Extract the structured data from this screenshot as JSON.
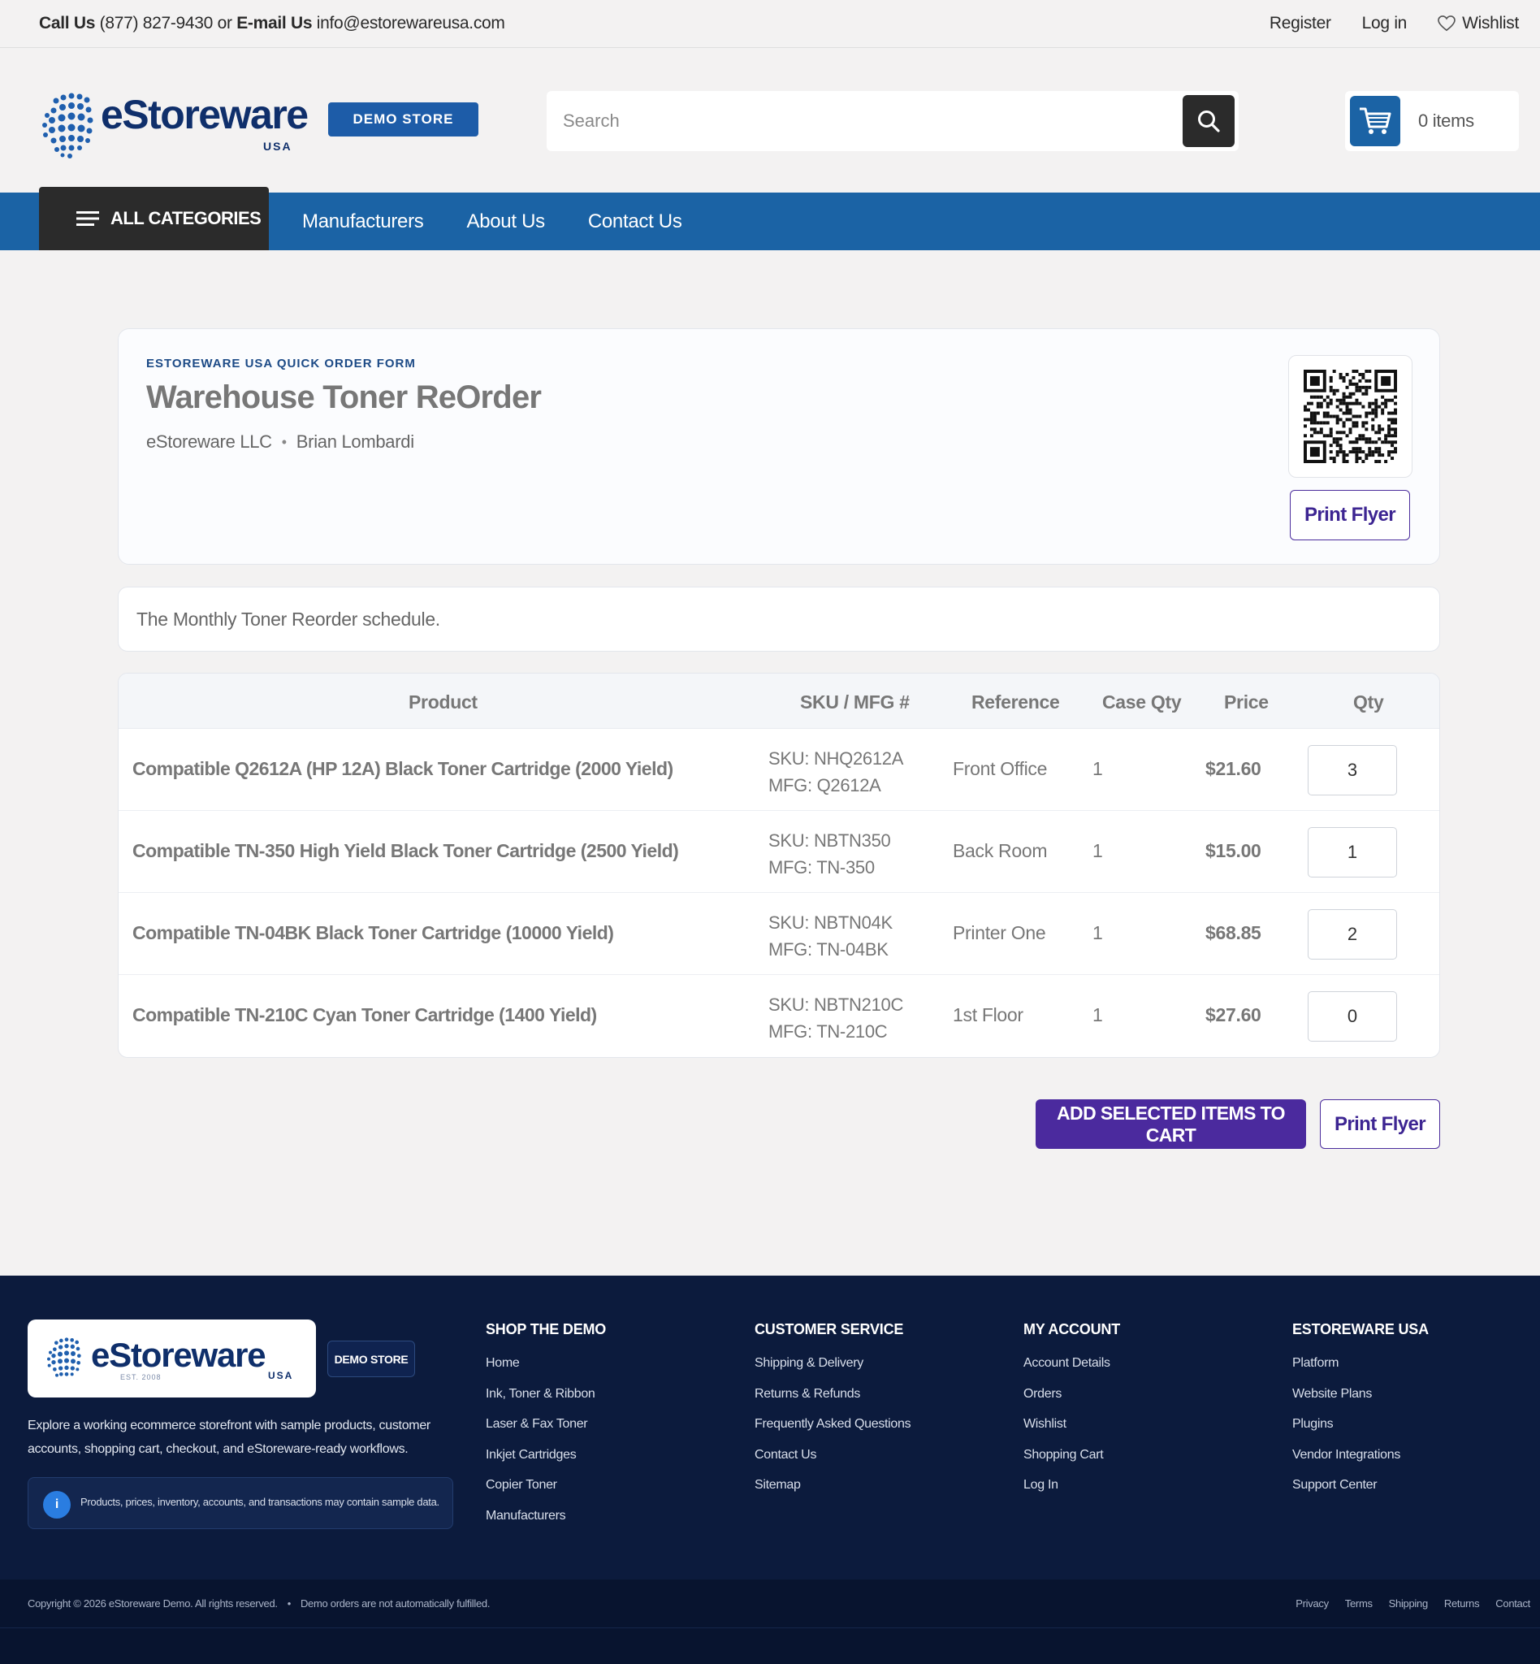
{
  "topbar": {
    "call_label": "Call Us",
    "phone": "(877) 827-9430",
    "or": "or",
    "email_label": "E-mail Us",
    "email": "info@estorewareusa.com",
    "register": "Register",
    "login": "Log in",
    "wishlist": "Wishlist"
  },
  "header": {
    "logo_text": "eStoreware",
    "logo_sub": "USA",
    "logo_badge": "DEMO STORE",
    "search_placeholder": "Search",
    "cart_count": "0 items"
  },
  "nav": {
    "all_categories": "ALL CATEGORIES",
    "links": [
      "Manufacturers",
      "About Us",
      "Contact Us"
    ]
  },
  "order_form": {
    "eyebrow": "ESTOREWARE USA QUICK ORDER FORM",
    "title": "Warehouse Toner ReOrder",
    "company": "eStoreware LLC",
    "person": "Brian Lombardi",
    "print_label": "Print Flyer",
    "description": "The Monthly Toner Reorder schedule."
  },
  "table": {
    "headers": {
      "product": "Product",
      "sku": "SKU / MFG #",
      "reference": "Reference",
      "case_qty": "Case Qty",
      "price": "Price",
      "qty": "Qty"
    },
    "rows": [
      {
        "product": "Compatible Q2612A (HP 12A) Black Toner Cartridge (2000 Yield)",
        "sku": "SKU: NHQ2612A",
        "mfg": "MFG: Q2612A",
        "reference": "Front Office",
        "case_qty": "1",
        "price": "$21.60",
        "qty": "3"
      },
      {
        "product": "Compatible TN-350 High Yield Black Toner Cartridge (2500 Yield)",
        "sku": "SKU: NBTN350",
        "mfg": "MFG: TN-350",
        "reference": "Back Room",
        "case_qty": "1",
        "price": "$15.00",
        "qty": "1"
      },
      {
        "product": "Compatible TN-04BK Black Toner Cartridge (10000 Yield)",
        "sku": "SKU: NBTN04K",
        "mfg": "MFG: TN-04BK",
        "reference": "Printer One",
        "case_qty": "1",
        "price": "$68.85",
        "qty": "2"
      },
      {
        "product": "Compatible TN-210C Cyan Toner Cartridge (1400 Yield)",
        "sku": "SKU: NBTN210C",
        "mfg": "MFG: TN-210C",
        "reference": "1st Floor",
        "case_qty": "1",
        "price": "$27.60",
        "qty": "0"
      }
    ]
  },
  "actions": {
    "add_to_cart": "ADD SELECTED ITEMS TO CART",
    "print_flyer": "Print Flyer"
  },
  "footer": {
    "logo_text": "eStoreware",
    "logo_sub": "USA",
    "logo_est": "EST. 2008",
    "badge": "DEMO STORE",
    "about": "Explore a working ecommerce storefront with sample products, customer accounts, shopping cart, checkout, and eStoreware-ready workflows.",
    "note": "Products, prices, inventory, accounts, and transactions may contain sample data.",
    "columns": [
      {
        "title": "SHOP THE DEMO",
        "links": [
          "Home",
          "Ink, Toner & Ribbon",
          "Laser & Fax Toner",
          "Inkjet Cartridges",
          "Copier Toner",
          "Manufacturers"
        ]
      },
      {
        "title": "CUSTOMER SERVICE",
        "links": [
          "Shipping & Delivery",
          "Returns & Refunds",
          "Frequently Asked Questions",
          "Contact Us",
          "Sitemap"
        ]
      },
      {
        "title": "MY ACCOUNT",
        "links": [
          "Account Details",
          "Orders",
          "Wishlist",
          "Shopping Cart",
          "Log In"
        ]
      },
      {
        "title": "ESTOREWARE USA",
        "links": [
          "Platform",
          "Website Plans",
          "Plugins",
          "Vendor Integrations",
          "Support Center"
        ]
      }
    ],
    "copyright": "Copyright © 2026 eStoreware Demo. All rights reserved.",
    "bullet": "•",
    "disclaimer": "Demo orders are not automatically fulfilled.",
    "bottom_links": [
      "Privacy",
      "Terms",
      "Shipping",
      "Returns",
      "Contact"
    ]
  },
  "colors": {
    "brand_blue": "#1b63a5",
    "primary_purple": "#4b2a9e",
    "footer_navy": "#0c1b3d",
    "dark_button": "#2b2b2b"
  },
  "icons": [
    "heart-icon",
    "search-icon",
    "cart-icon",
    "menu-icon",
    "qr-code",
    "info-icon"
  ]
}
